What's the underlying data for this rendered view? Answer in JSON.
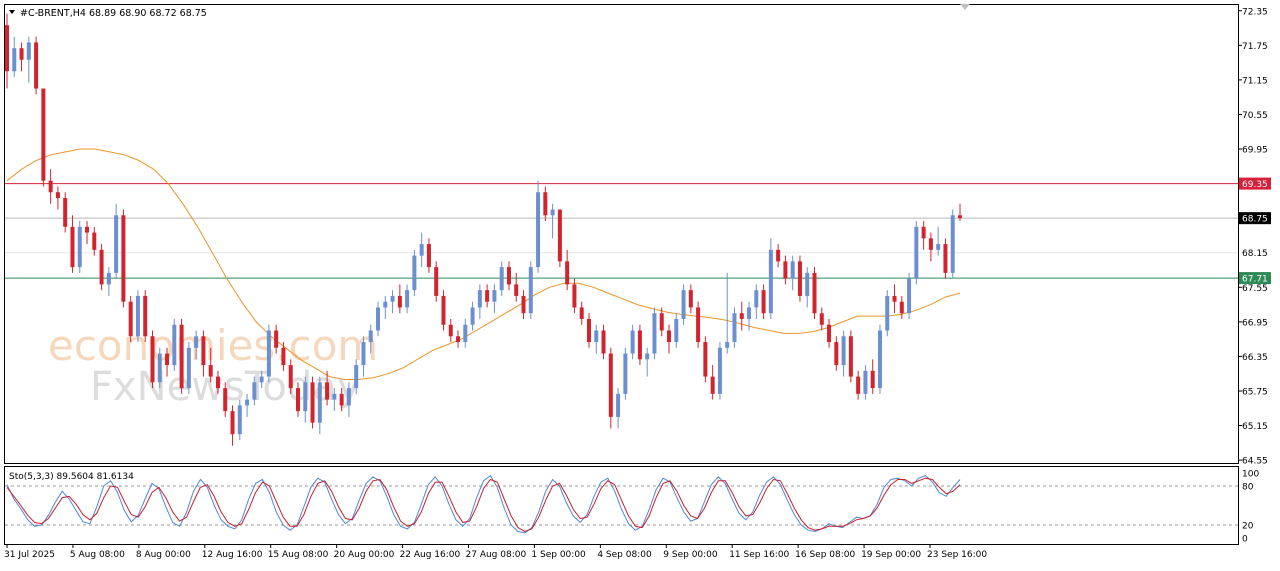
{
  "symbol_header": {
    "symbol": "#C-BRENT,H4",
    "ohlc": "68.89 68.90 68.72 68.75"
  },
  "watermark": {
    "line1": "economies.com",
    "line2": "FxNewsToday"
  },
  "colors": {
    "background": "#ffffff",
    "bull": "#6c8fd0",
    "bear": "#d1242f",
    "sma": "#e8962a",
    "resistance_line": "#d8203a",
    "support_line": "#2e8b57",
    "price_line": "#b9b9b9",
    "stoch_main": "#4f88d8",
    "stoch_signal": "#c81f2b",
    "grid_border": "#000000",
    "watermark_orange": "#f2c9a6",
    "watermark_gray": "#d9d9d9"
  },
  "chart_data": {
    "type": "candlestick",
    "price_axis": {
      "ticks": [
        72.35,
        71.75,
        71.15,
        70.55,
        69.95,
        67.55,
        66.95,
        66.35,
        65.75,
        65.15,
        64.55
      ],
      "ylim": [
        64.5,
        72.45
      ]
    },
    "levels": [
      {
        "name": "resistance",
        "value": 69.35,
        "label": "69.35"
      },
      {
        "name": "current",
        "value": 68.75,
        "label": "68.75"
      },
      {
        "name": "support",
        "value": 67.71,
        "label": "67.71"
      },
      {
        "name": "faint-level",
        "value": 68.15,
        "label": "68.15"
      }
    ],
    "time_labels": [
      "31 Jul 2025",
      "5 Aug 08:00",
      "8 Aug 00:00",
      "12 Aug 16:00",
      "15 Aug 08:00",
      "20 Aug 00:00",
      "22 Aug 16:00",
      "27 Aug 08:00",
      "1 Sep 00:00",
      "4 Sep 08:00",
      "9 Sep 00:00",
      "11 Sep 16:00",
      "16 Sep 08:00",
      "19 Sep 00:00",
      "23 Sep 16:00"
    ],
    "candles": [
      [
        72.1,
        72.3,
        71.0,
        71.3
      ],
      [
        71.3,
        71.9,
        71.2,
        71.7
      ],
      [
        71.7,
        71.8,
        71.3,
        71.5
      ],
      [
        71.5,
        71.9,
        71.1,
        71.8
      ],
      [
        71.8,
        71.9,
        70.9,
        71.0
      ],
      [
        71.0,
        71.0,
        69.3,
        69.4
      ],
      [
        69.4,
        69.6,
        69.0,
        69.2
      ],
      [
        69.2,
        69.3,
        68.9,
        69.1
      ],
      [
        69.1,
        69.2,
        68.5,
        68.6
      ],
      [
        68.6,
        68.8,
        67.8,
        67.9
      ],
      [
        67.9,
        68.7,
        67.8,
        68.6
      ],
      [
        68.6,
        68.7,
        68.3,
        68.5
      ],
      [
        68.5,
        68.6,
        68.1,
        68.2
      ],
      [
        68.2,
        68.3,
        67.5,
        67.6
      ],
      [
        67.6,
        67.9,
        67.4,
        67.8
      ],
      [
        67.8,
        69.0,
        67.7,
        68.8
      ],
      [
        68.8,
        68.9,
        67.2,
        67.3
      ],
      [
        67.3,
        67.4,
        66.6,
        66.7
      ],
      [
        66.7,
        67.5,
        66.6,
        67.4
      ],
      [
        67.4,
        67.5,
        66.6,
        66.7
      ],
      [
        66.7,
        66.8,
        65.8,
        65.9
      ],
      [
        65.9,
        66.5,
        65.8,
        66.4
      ],
      [
        66.4,
        66.5,
        66.0,
        66.2
      ],
      [
        66.2,
        67.0,
        66.1,
        66.9
      ],
      [
        66.9,
        67.0,
        65.7,
        65.8
      ],
      [
        65.8,
        66.6,
        65.7,
        66.5
      ],
      [
        66.5,
        66.8,
        66.3,
        66.7
      ],
      [
        66.7,
        66.8,
        66.0,
        66.2
      ],
      [
        66.2,
        66.5,
        65.9,
        66.0
      ],
      [
        66.0,
        66.1,
        65.7,
        65.8
      ],
      [
        65.8,
        65.9,
        65.3,
        65.4
      ],
      [
        65.4,
        65.5,
        64.8,
        65.0
      ],
      [
        65.0,
        65.6,
        64.9,
        65.5
      ],
      [
        65.5,
        65.7,
        65.3,
        65.6
      ],
      [
        65.6,
        66.0,
        65.5,
        65.9
      ],
      [
        65.9,
        66.1,
        65.8,
        66.0
      ],
      [
        66.0,
        66.9,
        65.9,
        66.8
      ],
      [
        66.8,
        66.9,
        66.4,
        66.5
      ],
      [
        66.5,
        66.6,
        66.1,
        66.2
      ],
      [
        66.2,
        66.3,
        65.7,
        65.8
      ],
      [
        65.8,
        65.9,
        65.3,
        65.4
      ],
      [
        65.4,
        66.0,
        65.2,
        65.9
      ],
      [
        65.9,
        66.0,
        65.1,
        65.2
      ],
      [
        65.2,
        66.0,
        65.0,
        65.9
      ],
      [
        65.9,
        66.1,
        65.5,
        65.6
      ],
      [
        65.6,
        65.8,
        65.4,
        65.7
      ],
      [
        65.7,
        65.8,
        65.4,
        65.5
      ],
      [
        65.5,
        65.9,
        65.3,
        65.8
      ],
      [
        65.8,
        66.3,
        65.7,
        66.2
      ],
      [
        66.2,
        66.7,
        66.0,
        66.6
      ],
      [
        66.6,
        66.9,
        66.4,
        66.8
      ],
      [
        66.8,
        67.3,
        66.7,
        67.2
      ],
      [
        67.2,
        67.4,
        67.0,
        67.3
      ],
      [
        67.3,
        67.5,
        67.1,
        67.4
      ],
      [
        67.4,
        67.6,
        67.1,
        67.2
      ],
      [
        67.2,
        67.6,
        67.1,
        67.5
      ],
      [
        67.5,
        68.2,
        67.4,
        68.1
      ],
      [
        68.1,
        68.5,
        67.9,
        68.3
      ],
      [
        68.3,
        68.4,
        67.8,
        67.9
      ],
      [
        67.9,
        68.0,
        67.3,
        67.4
      ],
      [
        67.4,
        67.5,
        66.8,
        66.9
      ],
      [
        66.9,
        67.0,
        66.6,
        66.7
      ],
      [
        66.7,
        66.8,
        66.5,
        66.6
      ],
      [
        66.6,
        67.0,
        66.5,
        66.9
      ],
      [
        66.9,
        67.3,
        66.8,
        67.2
      ],
      [
        67.2,
        67.6,
        67.0,
        67.5
      ],
      [
        67.5,
        67.6,
        67.2,
        67.3
      ],
      [
        67.3,
        67.6,
        67.1,
        67.5
      ],
      [
        67.5,
        68.0,
        67.4,
        67.9
      ],
      [
        67.9,
        68.0,
        67.5,
        67.6
      ],
      [
        67.6,
        67.8,
        67.3,
        67.4
      ],
      [
        67.4,
        67.5,
        67.0,
        67.1
      ],
      [
        67.1,
        68.0,
        67.0,
        67.9
      ],
      [
        67.9,
        69.4,
        67.8,
        69.2
      ],
      [
        69.2,
        69.3,
        68.7,
        68.8
      ],
      [
        68.8,
        69.0,
        68.4,
        68.9
      ],
      [
        68.9,
        68.9,
        67.9,
        68.0
      ],
      [
        68.0,
        68.2,
        67.5,
        67.6
      ],
      [
        67.6,
        67.7,
        67.1,
        67.2
      ],
      [
        67.2,
        67.3,
        66.9,
        67.0
      ],
      [
        67.0,
        67.1,
        66.5,
        66.6
      ],
      [
        66.6,
        66.9,
        66.4,
        66.8
      ],
      [
        66.8,
        66.9,
        66.3,
        66.4
      ],
      [
        66.4,
        66.5,
        65.1,
        65.3
      ],
      [
        65.3,
        65.8,
        65.1,
        65.7
      ],
      [
        65.7,
        66.5,
        65.6,
        66.4
      ],
      [
        66.4,
        66.9,
        66.3,
        66.8
      ],
      [
        66.8,
        66.9,
        66.2,
        66.3
      ],
      [
        66.3,
        66.5,
        66.0,
        66.4
      ],
      [
        66.4,
        67.2,
        66.3,
        67.1
      ],
      [
        67.1,
        67.2,
        66.7,
        66.8
      ],
      [
        66.8,
        66.9,
        66.4,
        66.6
      ],
      [
        66.6,
        67.1,
        66.5,
        67.0
      ],
      [
        67.0,
        67.6,
        66.9,
        67.5
      ],
      [
        67.5,
        67.6,
        67.1,
        67.2
      ],
      [
        67.2,
        67.3,
        66.5,
        66.6
      ],
      [
        66.6,
        66.7,
        65.9,
        66.0
      ],
      [
        66.0,
        66.2,
        65.6,
        65.7
      ],
      [
        65.7,
        66.6,
        65.6,
        66.5
      ],
      [
        66.5,
        67.8,
        66.4,
        66.6
      ],
      [
        66.6,
        67.2,
        66.5,
        67.1
      ],
      [
        67.1,
        67.3,
        66.8,
        67.0
      ],
      [
        67.0,
        67.3,
        66.8,
        67.2
      ],
      [
        67.2,
        67.6,
        67.0,
        67.5
      ],
      [
        67.5,
        67.6,
        67.0,
        67.1
      ],
      [
        67.1,
        68.4,
        67.0,
        68.2
      ],
      [
        68.2,
        68.3,
        67.9,
        68.0
      ],
      [
        68.0,
        68.1,
        67.6,
        67.7
      ],
      [
        67.7,
        68.1,
        67.5,
        68.0
      ],
      [
        68.0,
        68.1,
        67.3,
        67.4
      ],
      [
        67.4,
        67.9,
        67.2,
        67.8
      ],
      [
        67.8,
        67.9,
        67.0,
        67.1
      ],
      [
        67.1,
        67.2,
        66.8,
        66.9
      ],
      [
        66.9,
        67.0,
        66.5,
        66.6
      ],
      [
        66.6,
        66.7,
        66.1,
        66.2
      ],
      [
        66.2,
        66.8,
        66.0,
        66.7
      ],
      [
        66.7,
        66.8,
        65.9,
        66.0
      ],
      [
        66.0,
        66.1,
        65.6,
        65.7
      ],
      [
        65.7,
        66.2,
        65.6,
        66.1
      ],
      [
        66.1,
        66.3,
        65.7,
        65.8
      ],
      [
        65.8,
        66.9,
        65.7,
        66.8
      ],
      [
        66.8,
        67.5,
        66.7,
        67.4
      ],
      [
        67.4,
        67.6,
        67.1,
        67.3
      ],
      [
        67.3,
        67.4,
        67.0,
        67.1
      ],
      [
        67.1,
        67.8,
        67.0,
        67.7
      ],
      [
        67.7,
        68.7,
        67.6,
        68.6
      ],
      [
        68.6,
        68.7,
        68.2,
        68.4
      ],
      [
        68.4,
        68.5,
        68.0,
        68.2
      ],
      [
        68.2,
        68.6,
        68.1,
        68.3
      ],
      [
        68.3,
        68.4,
        67.7,
        67.8
      ],
      [
        67.8,
        68.9,
        67.7,
        68.8
      ],
      [
        68.8,
        69.0,
        68.7,
        68.75
      ]
    ],
    "sma": [
      69.4,
      69.6,
      69.75,
      69.85,
      69.9,
      69.95,
      69.95,
      69.9,
      69.85,
      69.75,
      69.6,
      69.35,
      69.0,
      68.6,
      68.15,
      67.7,
      67.3,
      66.95,
      66.7,
      66.5,
      66.3,
      66.15,
      66.0,
      65.95,
      65.95,
      65.98,
      66.05,
      66.15,
      66.3,
      66.45,
      66.55,
      66.65,
      66.8,
      66.95,
      67.1,
      67.25,
      67.42,
      67.55,
      67.62,
      67.62,
      67.55,
      67.45,
      67.35,
      67.25,
      67.18,
      67.12,
      67.08,
      67.05,
      67.02,
      66.98,
      66.92,
      66.85,
      66.8,
      66.75,
      66.75,
      66.78,
      66.85,
      66.95,
      67.05,
      67.05,
      67.05,
      67.08,
      67.15,
      67.25,
      67.38,
      67.45
    ],
    "stochastic": {
      "label": "Sto(5,3,3) 89.5604 81.6134",
      "levels": [
        100,
        80,
        20,
        0
      ],
      "main": [
        82,
        60,
        45,
        28,
        18,
        20,
        35,
        55,
        72,
        60,
        42,
        25,
        22,
        48,
        80,
        88,
        70,
        42,
        25,
        35,
        60,
        84,
        76,
        48,
        24,
        18,
        40,
        72,
        90,
        78,
        50,
        28,
        18,
        14,
        28,
        60,
        84,
        90,
        70,
        40,
        20,
        12,
        20,
        48,
        78,
        92,
        86,
        60,
        36,
        22,
        30,
        58,
        84,
        94,
        88,
        64,
        36,
        18,
        14,
        24,
        52,
        82,
        94,
        80,
        52,
        28,
        18,
        30,
        62,
        88,
        96,
        78,
        46,
        20,
        10,
        8,
        16,
        40,
        72,
        90,
        80,
        54,
        34,
        24,
        36,
        64,
        86,
        92,
        72,
        44,
        22,
        12,
        18,
        44,
        74,
        92,
        86,
        62,
        40,
        26,
        30,
        56,
        82,
        94,
        84,
        60,
        38,
        28,
        40,
        66,
        86,
        94,
        82,
        58,
        36,
        20,
        12,
        10,
        14,
        22,
        18,
        16,
        24,
        32,
        30,
        34,
        52,
        78,
        90,
        92,
        88,
        80,
        92,
        96,
        86,
        70,
        64,
        78,
        90
      ],
      "signal": [
        78,
        64,
        50,
        35,
        24,
        22,
        30,
        46,
        62,
        64,
        52,
        36,
        28,
        38,
        62,
        80,
        78,
        56,
        36,
        32,
        48,
        70,
        78,
        62,
        40,
        26,
        32,
        56,
        78,
        82,
        64,
        40,
        24,
        18,
        22,
        44,
        70,
        86,
        80,
        56,
        32,
        18,
        18,
        36,
        64,
        84,
        88,
        72,
        48,
        30,
        28,
        46,
        72,
        88,
        90,
        74,
        48,
        26,
        18,
        22,
        40,
        68,
        86,
        86,
        64,
        40,
        24,
        26,
        48,
        76,
        90,
        86,
        60,
        34,
        16,
        10,
        14,
        32,
        58,
        80,
        84,
        66,
        44,
        30,
        32,
        52,
        76,
        88,
        82,
        58,
        34,
        18,
        16,
        34,
        62,
        84,
        88,
        72,
        50,
        34,
        30,
        46,
        70,
        88,
        88,
        70,
        48,
        34,
        36,
        54,
        76,
        90,
        88,
        68,
        46,
        28,
        16,
        12,
        14,
        18,
        18,
        18,
        22,
        28,
        30,
        34,
        46,
        66,
        82,
        90,
        90,
        84,
        88,
        92,
        90,
        78,
        68,
        72,
        82
      ]
    }
  }
}
